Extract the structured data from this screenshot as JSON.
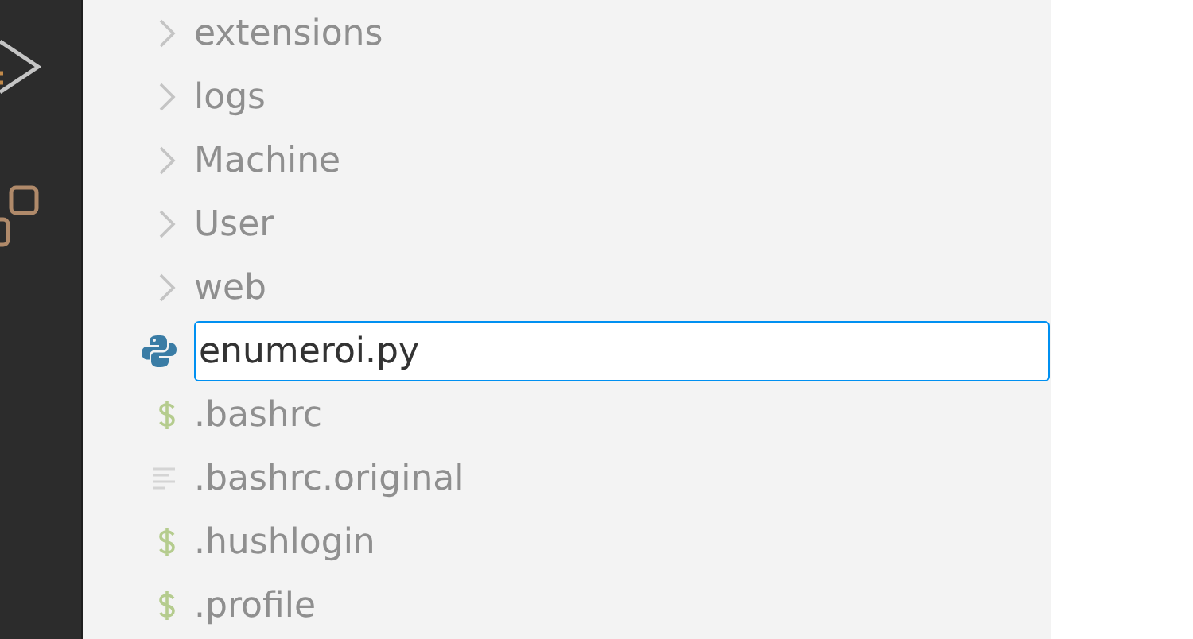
{
  "activity_bar": {
    "items": [
      {
        "kind": "run"
      },
      {
        "kind": "extensions"
      }
    ]
  },
  "explorer": {
    "items": [
      {
        "kind": "folder",
        "label": "extensions"
      },
      {
        "kind": "folder",
        "label": "logs"
      },
      {
        "kind": "folder",
        "label": "Machine"
      },
      {
        "kind": "folder",
        "label": "User"
      },
      {
        "kind": "folder",
        "label": "web"
      },
      {
        "kind": "python_input",
        "value": "enumeroi.py"
      },
      {
        "kind": "shell",
        "label": ".bashrc"
      },
      {
        "kind": "text",
        "label": ".bashrc.original"
      },
      {
        "kind": "shell",
        "label": ".hushlogin"
      },
      {
        "kind": "shell",
        "label": ".profile"
      }
    ]
  }
}
